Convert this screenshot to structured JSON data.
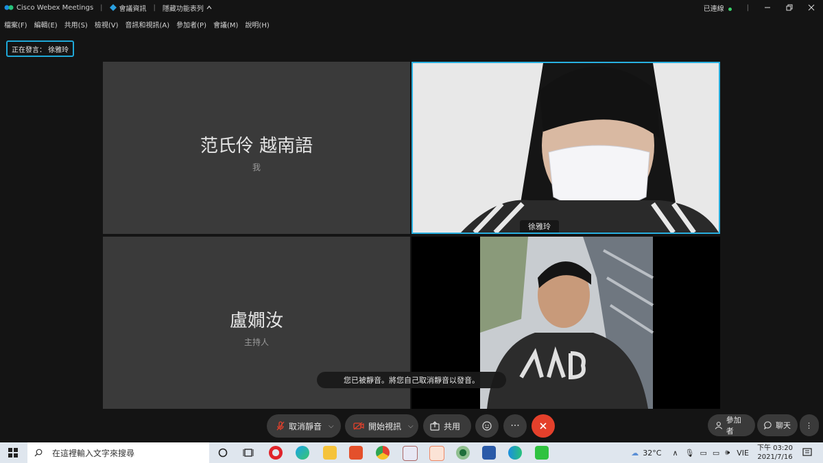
{
  "window": {
    "app_title": "Cisco Webex Meetings",
    "meeting_info": "會議資訊",
    "hide_menu": "隱藏功能表列",
    "connection_status": "已連線"
  },
  "menu": [
    "檔案(F)",
    "編輯(E)",
    "共用(S)",
    "檢視(V)",
    "音訊和視訊(A)",
    "參加者(P)",
    "會議(M)",
    "說明(H)"
  ],
  "speaker_label": "正在發言： 徐雅玲",
  "participants": {
    "p1": {
      "name": "范氏伶 越南語",
      "role": "我"
    },
    "p2": {
      "name": "徐雅玲"
    },
    "p3": {
      "name": "盧嫺汝",
      "role": "主持人"
    }
  },
  "toast": "您已被靜音。將您自己取消靜音以發音。",
  "controls": {
    "unmute": "取消靜音",
    "start_video": "開始視訊",
    "share": "共用",
    "participants": "參加者",
    "chat": "聊天"
  },
  "taskbar": {
    "search_placeholder": "在這裡輸入文字來搜尋",
    "weather": "32°C",
    "lang": "VIE",
    "time_period": "下午 03:20",
    "date": "2021/7/16"
  },
  "colors": {
    "accent": "#1fa8d8",
    "end_call": "#e4402b",
    "connected": "#3bd06a"
  }
}
